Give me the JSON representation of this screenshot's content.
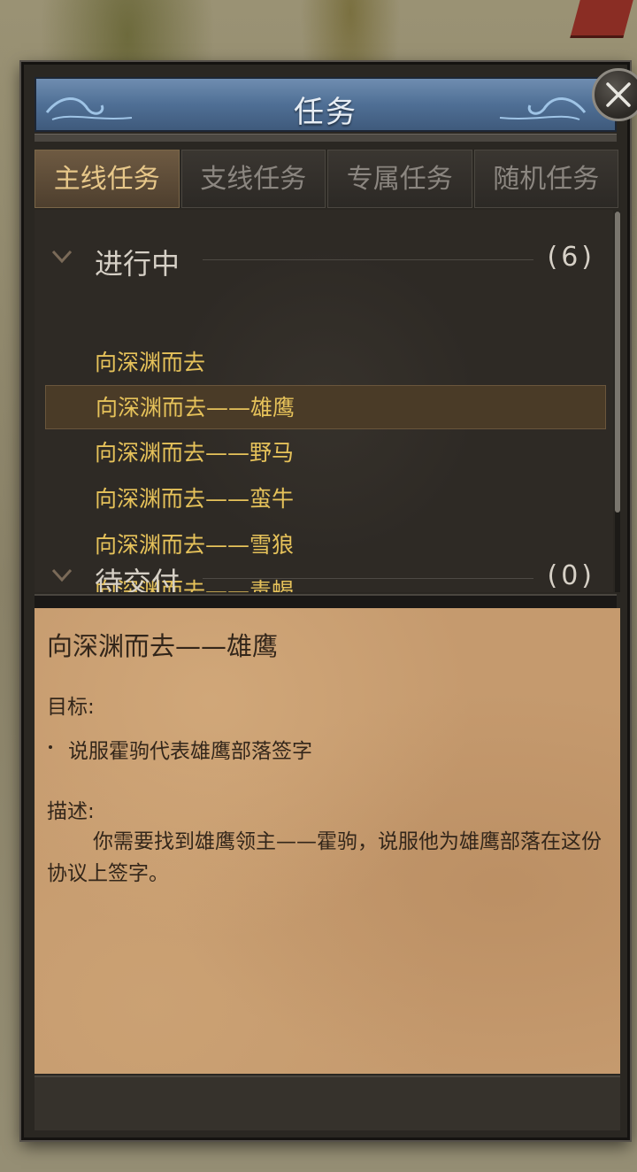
{
  "window": {
    "title": "任务"
  },
  "tabs": [
    {
      "label": "主线任务",
      "active": true
    },
    {
      "label": "支线任务",
      "active": false
    },
    {
      "label": "专属任务",
      "active": false
    },
    {
      "label": "随机任务",
      "active": false
    }
  ],
  "sections": {
    "in_progress": {
      "title": "进行中",
      "count": "(6)",
      "items": [
        "向深渊而去",
        "向深渊而去——雄鹰",
        "向深渊而去——野马",
        "向深渊而去——蛮牛",
        "向深渊而去——雪狼",
        "向深渊而去——毒蝎"
      ],
      "selected_index": 1
    },
    "pending": {
      "title": "待交付",
      "count": "(0)"
    }
  },
  "detail": {
    "title": "向深渊而去——雄鹰",
    "goal_label": "目标:",
    "goal": "说服霍驹代表雄鹰部落签字",
    "desc_label": "描述:",
    "desc": "你需要找到雄鹰领主——霍驹，说服他为雄鹰部落在这份协议上签字。"
  },
  "colors": {
    "quest_text": "#e6c25a",
    "active_tab_text": "#e8c88a",
    "title_bar": "#4f6f95",
    "parchment": "#c59a6e"
  },
  "icons": {
    "close": "close-icon",
    "collapse": "chevron-down-icon"
  }
}
